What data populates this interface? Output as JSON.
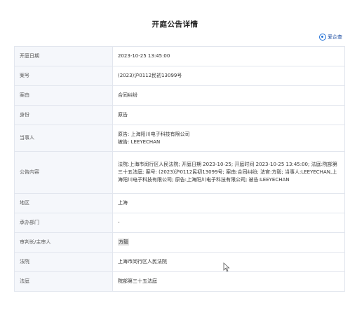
{
  "page": {
    "title": "开庭公告详情",
    "brand": "爱企查"
  },
  "rows": [
    {
      "label": "开庭日期",
      "value": "2023-10-25 13:45:00"
    },
    {
      "label": "案号",
      "value": "(2023)沪0112民初13099号"
    },
    {
      "label": "案由",
      "value": "合同纠纷"
    },
    {
      "label": "身份",
      "value": "原告"
    },
    {
      "label": "当事人",
      "value_lines": [
        "原告: 上海阳川电子科技有限公司",
        "被告: LEEYECHAN"
      ]
    },
    {
      "label": "公告内容",
      "value": "法院:上海市闵行区人民法院; 开庭日期 2023-10-25; 开庭时间 2023-10-25 13:45:00; 法庭:院部第三十五法庭; 案号: (2023)沪0112民初13099号; 案由:合同纠纷; 法官:方毅; 当事人:LEEYECHAN,上海阳川电子科技有限公司; 原告:上海阳川电子科技有限公司; 被告:LEEYECHAN"
    },
    {
      "label": "地区",
      "value": "上海"
    },
    {
      "label": "承办部门",
      "value": "-"
    },
    {
      "label": "审判长/主审人",
      "value": "方毅"
    },
    {
      "label": "法院",
      "value": "上海市闵行区人民法院"
    },
    {
      "label": "法庭",
      "value": "院部第三十五法庭"
    }
  ]
}
